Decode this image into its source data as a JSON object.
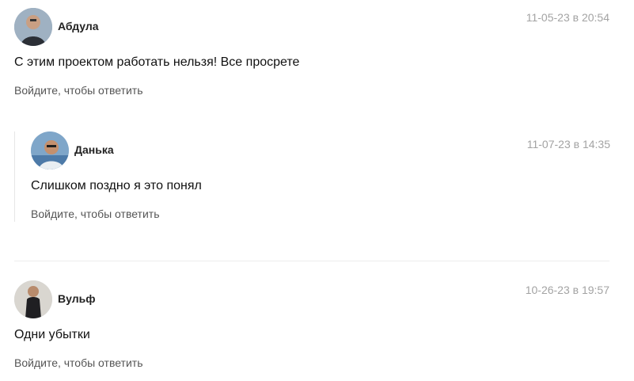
{
  "comments": [
    {
      "author": "Абдула",
      "date": "11-05-23 в 20:54",
      "text": "С этим проектом работать нельзя! Все просрете",
      "reply_label": "Войдите, чтобы ответить"
    },
    {
      "author": "Данька",
      "date": "11-07-23 в 14:35",
      "text": "Слишком поздно я это понял",
      "reply_label": "Войдите, чтобы ответить"
    },
    {
      "author": "Вульф",
      "date": "10-26-23 в 19:57",
      "text": "Одни убытки",
      "reply_label": "Войдите, чтобы ответить"
    }
  ]
}
